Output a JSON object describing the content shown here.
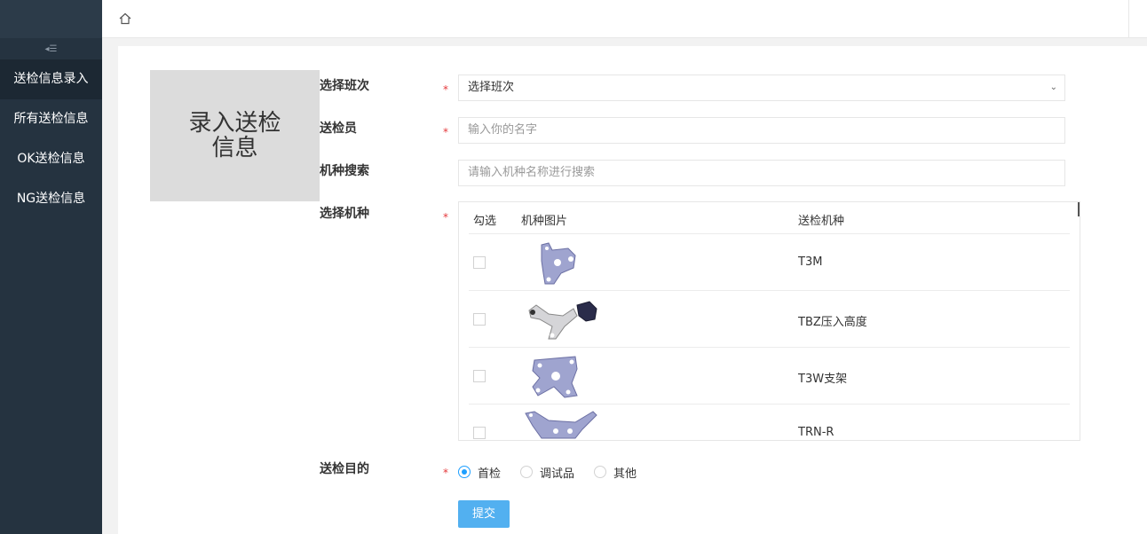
{
  "sidebar": {
    "collapse_icon": "collapse-menu-icon",
    "items": [
      {
        "label": "送检信息录入",
        "active": true
      },
      {
        "label": "所有送检信息",
        "active": false
      },
      {
        "label": "OK送检信息",
        "active": false
      },
      {
        "label": "NG送检信息",
        "active": false
      }
    ]
  },
  "topbar": {
    "home_icon": "home-icon"
  },
  "cover": {
    "text": "录入送检信息"
  },
  "form": {
    "shift": {
      "label": "选择班次",
      "required": "*",
      "value": "选择班次"
    },
    "inspector": {
      "label": "送检员",
      "required": "*",
      "placeholder": "输入你的名字"
    },
    "model_search": {
      "label": "机种搜索",
      "placeholder": "请输入机种名称进行搜索"
    },
    "model_select": {
      "label": "选择机种",
      "required": "*"
    },
    "purpose": {
      "label": "送检目的",
      "required": "*",
      "options": [
        "首检",
        "调试品",
        "其他"
      ],
      "selected": "首检"
    }
  },
  "table": {
    "headers": [
      "勾选",
      "机种图片",
      "送检机种"
    ],
    "rows": [
      {
        "model": "T3M",
        "image_icon": "part-t3m-image"
      },
      {
        "model": "TBZ压入高度",
        "image_icon": "part-tbz-image"
      },
      {
        "model": "T3W支架",
        "image_icon": "part-t3w-image"
      },
      {
        "model": "TRN-R",
        "image_icon": "part-trn-image"
      }
    ]
  },
  "submit_label": "提交",
  "colors": {
    "sidebar": "#253340",
    "accent": "#1e9fff",
    "button": "#52b0f0",
    "required": "#e4393c"
  }
}
